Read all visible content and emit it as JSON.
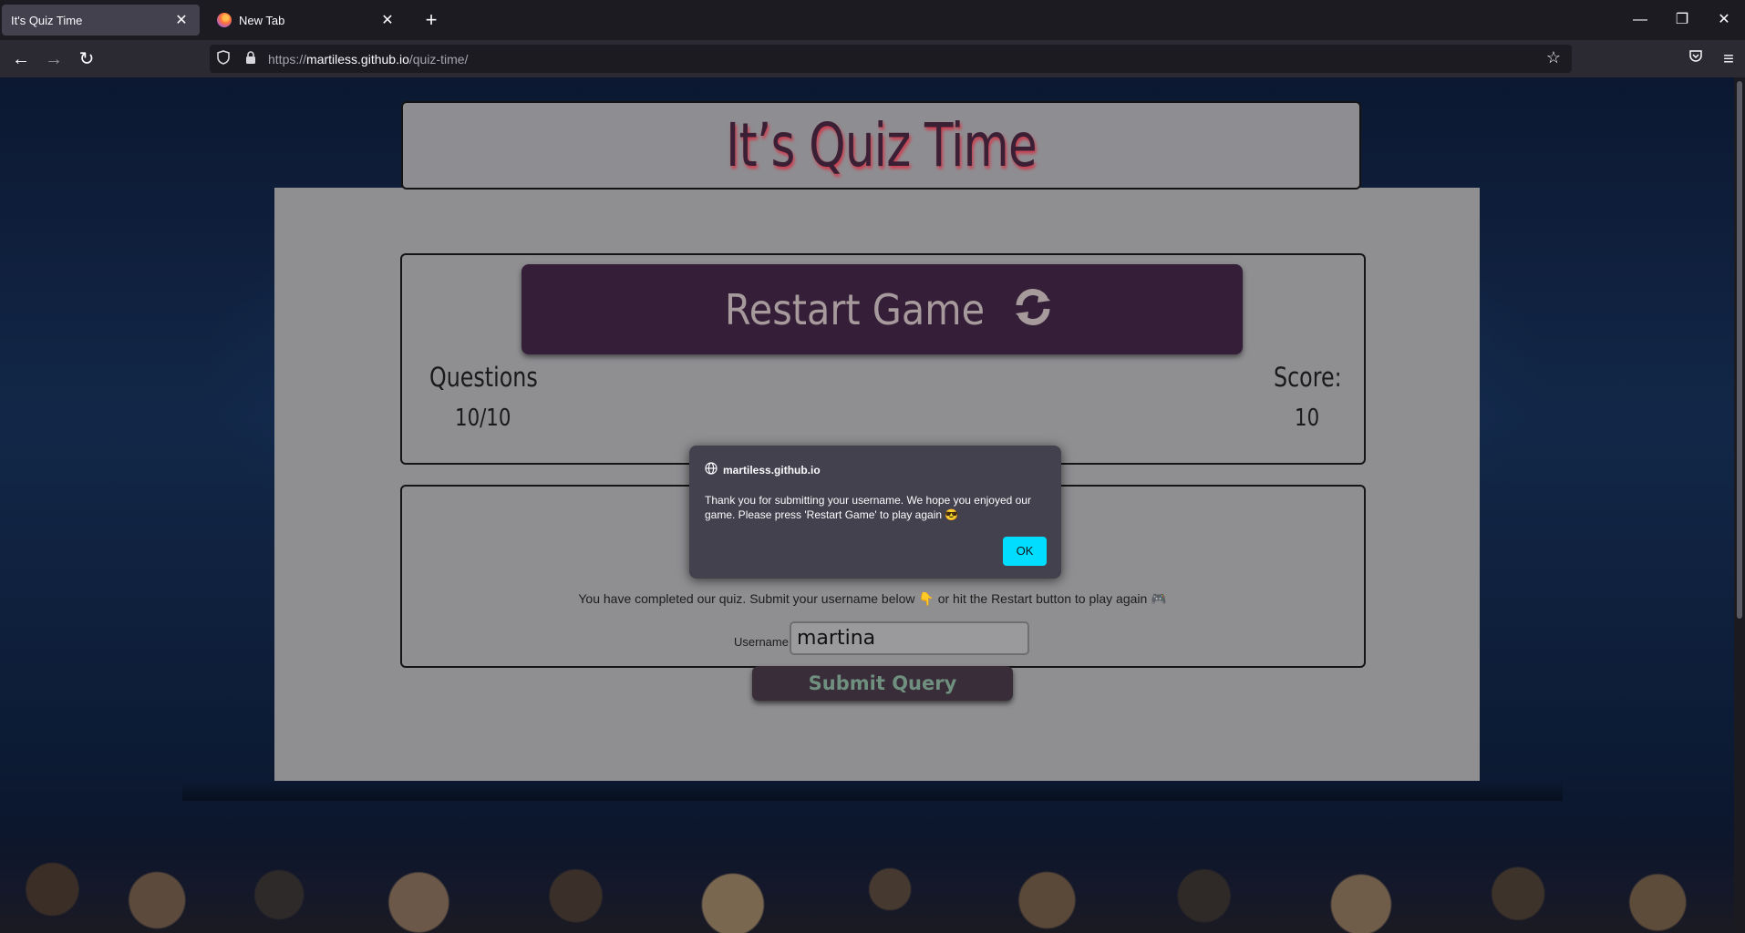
{
  "browser": {
    "tabs": [
      {
        "title": "It's Quiz Time",
        "active": true
      },
      {
        "title": "New Tab",
        "active": false
      }
    ],
    "url_prefix": "https://",
    "url_host": "martiless.github.io",
    "url_path": "/quiz-time/"
  },
  "page": {
    "title": "It’s Quiz Time",
    "restart_label": "Restart Game",
    "questions_label": "Questions",
    "questions_value": "10/10",
    "score_label": "Score:",
    "score_value": "10",
    "completion_text": "You have completed our quiz. Submit your username below 👇 or hit the Restart button to play again 🎮",
    "username_label": "Username",
    "username_value": "martina",
    "submit_label": "Submit Query"
  },
  "dialog": {
    "origin": "martiless.github.io",
    "message": "Thank you for submitting your username. We hope you enjoyed our game. Please press 'Restart Game' to play again 😎",
    "ok_label": "OK"
  },
  "colors": {
    "accent": "#00ddff",
    "restart_bg": "#351f38",
    "title_color": "#3a1f35"
  }
}
